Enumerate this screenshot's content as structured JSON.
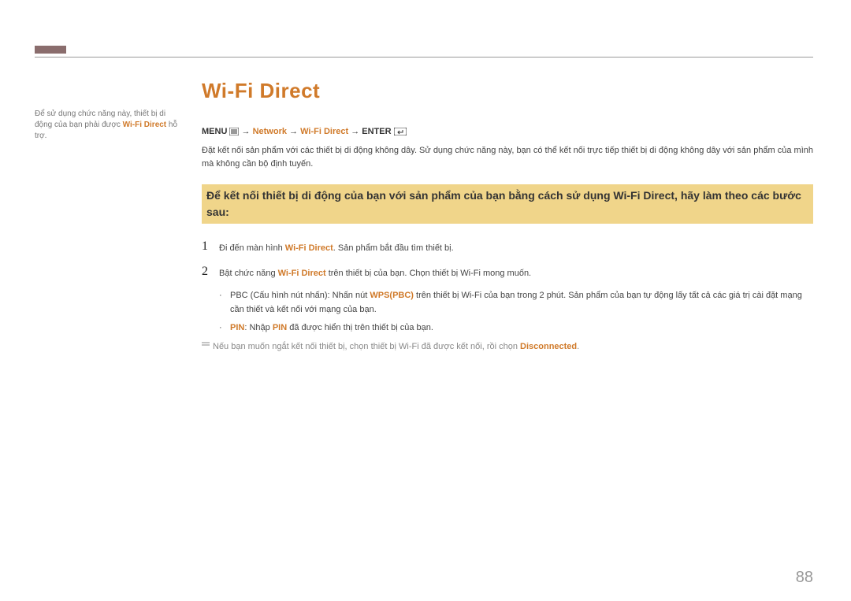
{
  "page_number": "88",
  "sidebar": {
    "line1": "Để sử dụng chức năng này, thiết bị di động của bạn phải được ",
    "highlight": "Wi-Fi Direct",
    "line2": " hỗ trợ."
  },
  "title": "Wi-Fi Direct",
  "breadcrumb": {
    "menu": "MENU",
    "arrow1": " → ",
    "network": "Network",
    "arrow2": " → ",
    "wifi": "Wi-Fi Direct",
    "arrow3": " → ",
    "enter": "ENTER"
  },
  "intro": "Đặt kết nối sản phẩm với các thiết bị di động không dây. Sử dụng chức năng này, bạn có thể kết nối trực tiếp thiết bị di động không dây với sản phẩm của mình mà không cần bộ định tuyến.",
  "highlight_heading": "Để kết nối thiết bị di động của bạn với sản phẩm của bạn bằng cách sử dụng Wi-Fi Direct, hãy làm theo các bước sau:",
  "steps": [
    {
      "num": "1",
      "pre": "Đi đến màn hình ",
      "orange": "Wi-Fi Direct",
      "post": ". Sản phẩm bắt đầu tìm thiết bị."
    },
    {
      "num": "2",
      "pre": "Bật chức năng ",
      "orange": "Wi-Fi Direct",
      "post": " trên thiết bị của bạn. Chọn thiết bị Wi-Fi mong muốn."
    }
  ],
  "bullets": [
    {
      "dot": "·",
      "pre": "PBC (Cấu hình nút nhấn): Nhấn nút ",
      "orange": "WPS(PBC)",
      "post": " trên thiết bị Wi-Fi của bạn trong 2 phút. Sản phẩm của bạn tự động lấy tất cả các giá trị cài đặt mạng cần thiết và kết nối với mạng của bạn."
    },
    {
      "dot": "·",
      "pre": "",
      "orange": "PIN",
      "mid": ": Nhập ",
      "orange2": "PIN",
      "post": " đã được hiển thị trên thiết bị của bạn."
    }
  ],
  "note": {
    "pre": "Nếu bạn muốn ngắt kết nối thiết bị, chọn thiết bị Wi-Fi đã được kết nối, rồi chọn ",
    "orange": "Disconnected",
    "post": "."
  }
}
